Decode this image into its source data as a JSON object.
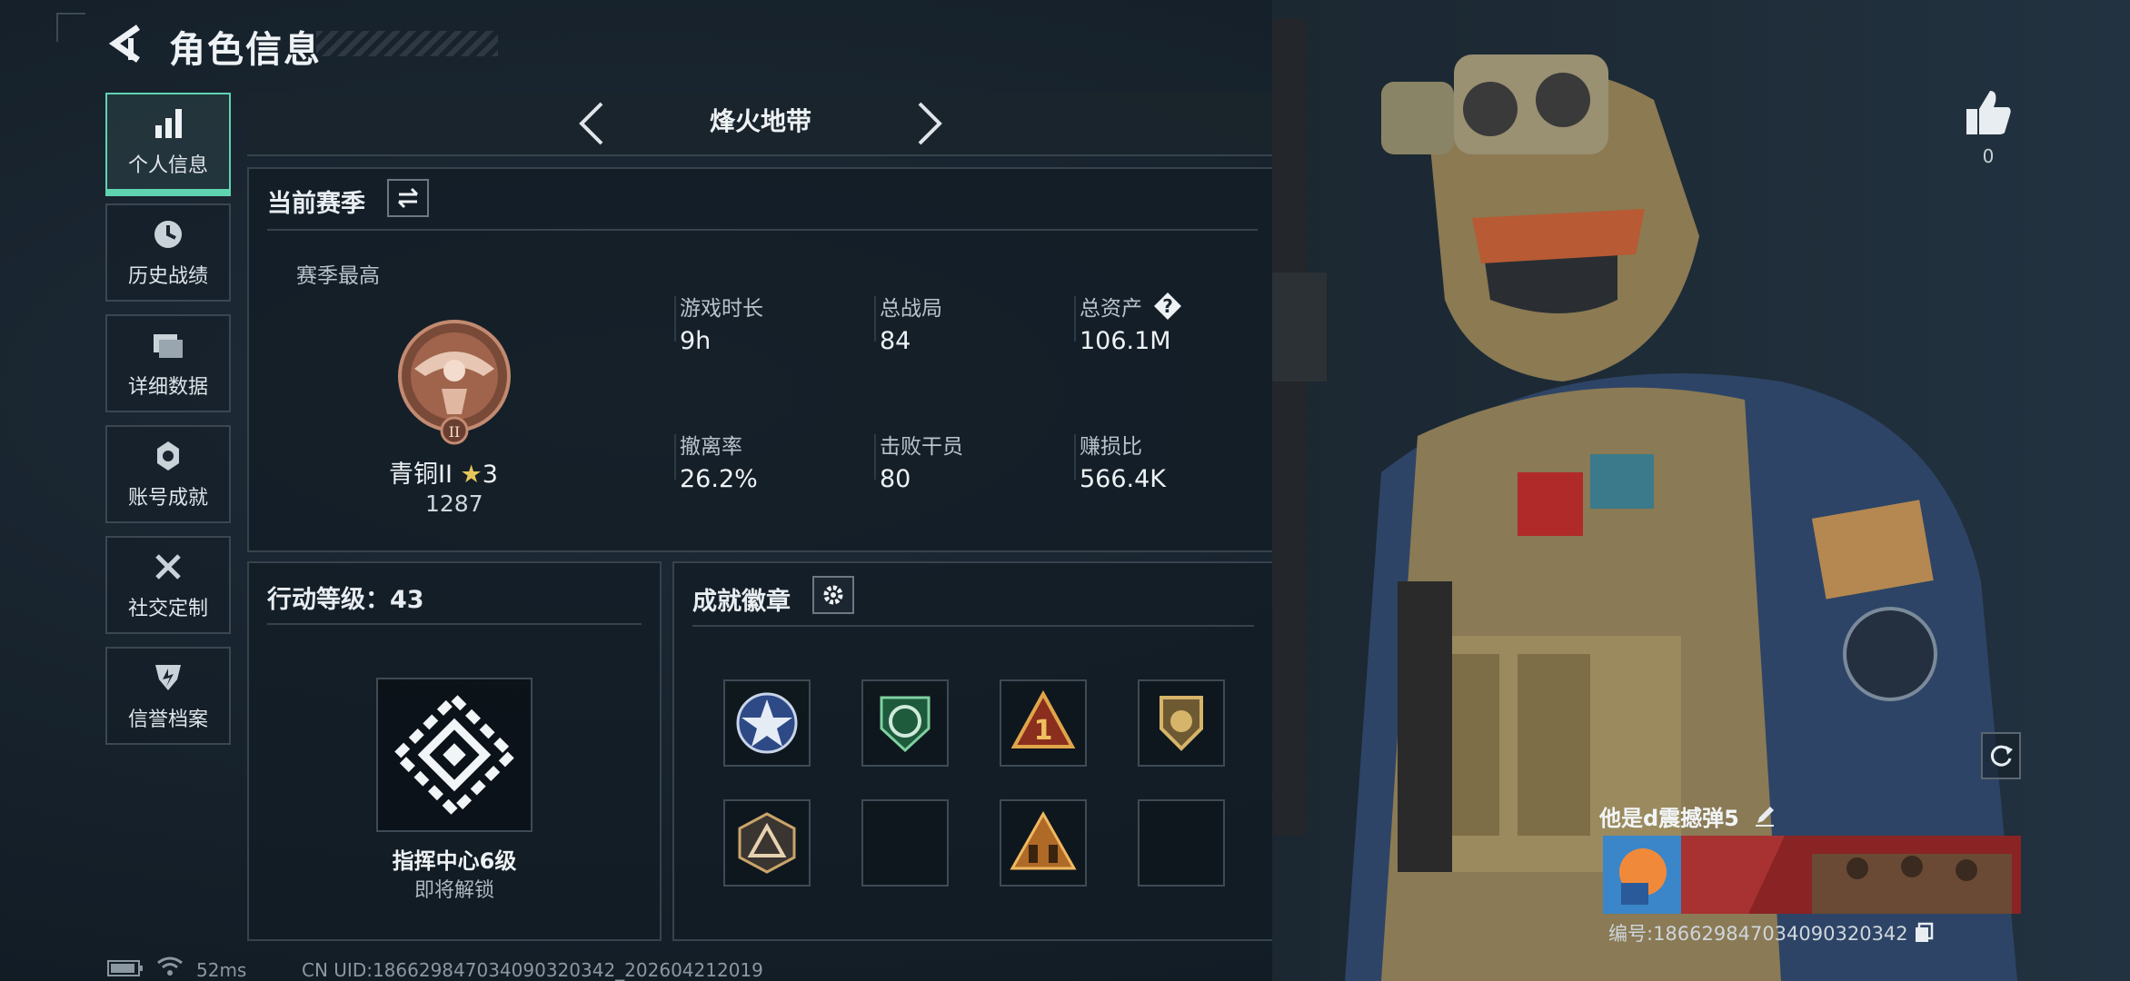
{
  "header": {
    "title": "角色信息"
  },
  "sidebar": {
    "items": [
      {
        "label": "个人信息",
        "icon": "bar-chart-icon",
        "active": true
      },
      {
        "label": "历史战绩",
        "icon": "clock-icon",
        "active": false
      },
      {
        "label": "详细数据",
        "icon": "folder-icon",
        "active": false
      },
      {
        "label": "账号成就",
        "icon": "medal-icon",
        "active": false
      },
      {
        "label": "社交定制",
        "icon": "tools-icon",
        "active": false
      },
      {
        "label": "信誉档案",
        "icon": "shield-icon",
        "active": false
      }
    ]
  },
  "mode": {
    "title": "烽火地带"
  },
  "season": {
    "title": "当前赛季",
    "best_label": "赛季最高",
    "rank_name": "青铜II",
    "rank_stars": "3",
    "rank_score": "1287",
    "stats": [
      {
        "label": "游戏时长",
        "value": "9h"
      },
      {
        "label": "总战局",
        "value": "84"
      },
      {
        "label": "总资产",
        "value": "106.1M"
      },
      {
        "label": "撤离率",
        "value": "26.2%"
      },
      {
        "label": "击败干员",
        "value": "80"
      },
      {
        "label": "赚损比",
        "value": "566.4K"
      }
    ],
    "help_symbol": "?"
  },
  "action_level": {
    "title": "行动等级：43",
    "badge_label": "指挥中心6级",
    "badge_status": "即将解锁"
  },
  "achievements": {
    "title": "成就徽章",
    "badges": [
      "star-badge-icon",
      "shield-green-badge-icon",
      "number-one-badge-icon",
      "gold-shield-badge-icon",
      "triangle-badge-icon",
      "empty-slot",
      "soldiers-badge-icon",
      "empty-slot"
    ]
  },
  "profile": {
    "likes": "0",
    "player_name": "他是d震撼弹5",
    "player_id": "编号:18662984703409032034​2"
  },
  "status_bar": {
    "ping": "52ms",
    "uid": "CN UID:186629847034090320342_202604212019"
  },
  "colors": {
    "accent": "#5fd3b0",
    "panel_border": "#36434e",
    "background": "#16222c"
  }
}
